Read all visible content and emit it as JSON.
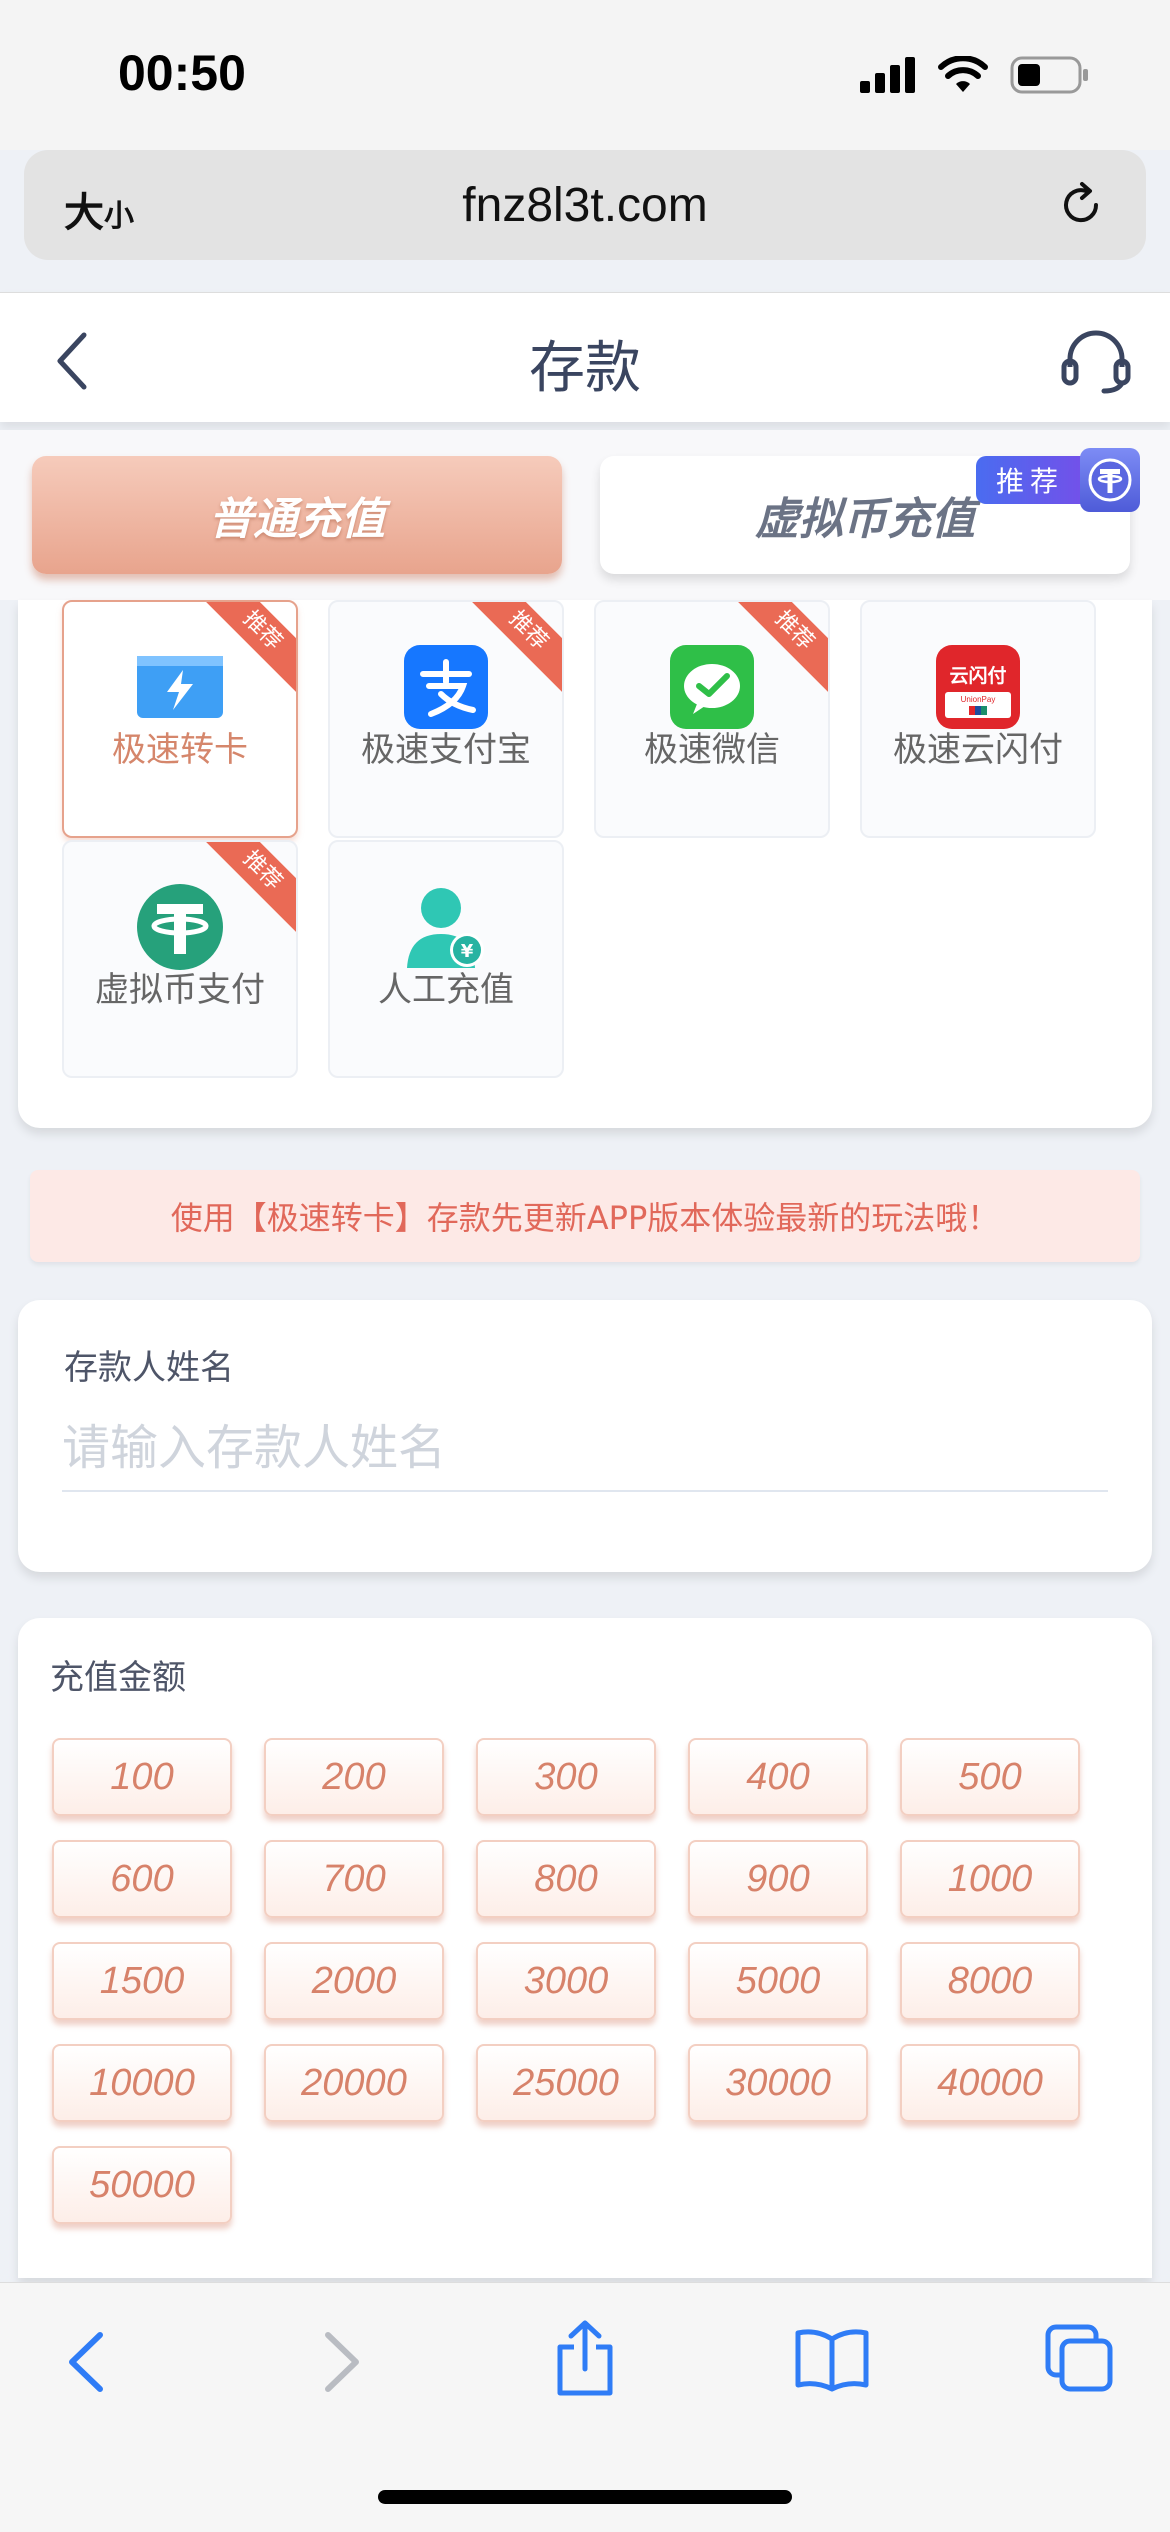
{
  "status": {
    "time": "00:50"
  },
  "browser": {
    "text_size_label": "大",
    "text_size_small": "小",
    "url": "fnz8l3t.com"
  },
  "header": {
    "title": "存款"
  },
  "tabs": {
    "normal_label": "普通充值",
    "crypto_label": "虚拟币充值",
    "crypto_badge": "推荐"
  },
  "methods": [
    {
      "label": "极速转卡",
      "ribbon": "推荐",
      "icon": "bank-card-icon",
      "selected": true
    },
    {
      "label": "极速支付宝",
      "ribbon": "推荐",
      "icon": "alipay-icon",
      "selected": false
    },
    {
      "label": "极速微信",
      "ribbon": "推荐",
      "icon": "wechat-icon",
      "selected": false
    },
    {
      "label": "极速云闪付",
      "ribbon": "",
      "icon": "unionpay-icon",
      "icon_text": "云闪付",
      "icon_subtext": "UnionPay",
      "selected": false
    },
    {
      "label": "虚拟币支付",
      "ribbon": "推荐",
      "icon": "tether-icon",
      "selected": false
    },
    {
      "label": "人工充值",
      "ribbon": "",
      "icon": "agent-icon",
      "selected": false
    }
  ],
  "notice": "使用【极速转卡】存款先更新APP版本体验最新的玩法哦！",
  "depositor": {
    "label": "存款人姓名",
    "placeholder": "请输入存款人姓名",
    "value": ""
  },
  "amount": {
    "label": "充值金额",
    "options": [
      "100",
      "200",
      "300",
      "400",
      "500",
      "600",
      "700",
      "800",
      "900",
      "1000",
      "1500",
      "2000",
      "3000",
      "5000",
      "8000",
      "10000",
      "20000",
      "25000",
      "30000",
      "40000",
      "50000"
    ]
  },
  "colors": {
    "accent": "#e8a48d",
    "ribbon": "#ea6a55",
    "ios_blue": "#2f7cf6"
  }
}
